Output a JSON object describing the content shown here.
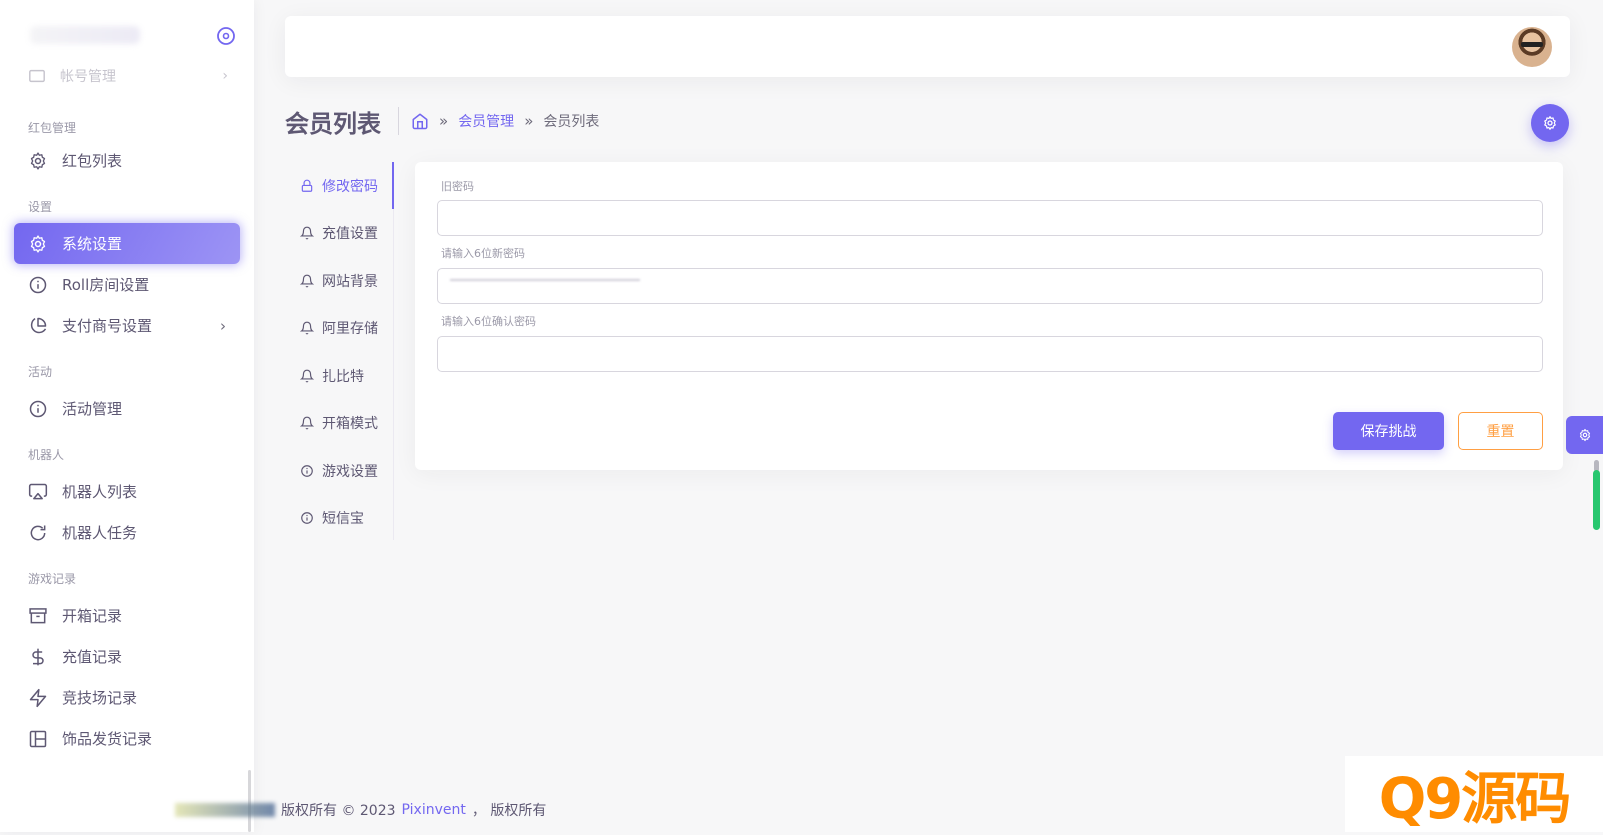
{
  "sidebar": {
    "faded_item": "帐号管理",
    "sections": {
      "hongbao": "红包管理",
      "settings": "设置",
      "activity": "活动",
      "robot": "机器人",
      "game_records": "游戏记录"
    },
    "items": {
      "hongbao_list": "红包列表",
      "system_settings": "系统设置",
      "roll_room": "Roll房间设置",
      "payment_merchant": "支付商号设置",
      "activity_manage": "活动管理",
      "robot_list": "机器人列表",
      "robot_task": "机器人任务",
      "unbox_records": "开箱记录",
      "recharge_records": "充值记录",
      "arena_records": "竞技场记录",
      "item_shipping_records": "饰品发货记录"
    }
  },
  "header": {
    "page_title": "会员列表",
    "breadcrumb": {
      "sep": "»",
      "parent": "会员管理",
      "current": "会员列表"
    }
  },
  "tabs": [
    {
      "label": "修改密码",
      "icon": "lock-icon",
      "active": true
    },
    {
      "label": "充值设置",
      "icon": "bell-icon"
    },
    {
      "label": "网站背景",
      "icon": "bell-icon"
    },
    {
      "label": "阿里存储",
      "icon": "bell-icon"
    },
    {
      "label": "扎比特",
      "icon": "bell-icon"
    },
    {
      "label": "开箱模式",
      "icon": "bell-icon"
    },
    {
      "label": "游戏设置",
      "icon": "info-icon"
    },
    {
      "label": "短信宝",
      "icon": "info-icon"
    }
  ],
  "form": {
    "old_password_label": "旧密码",
    "new_password_label": "请输入6位新密码",
    "confirm_password_label": "请输入6位确认密码",
    "save_label": "保存挑战",
    "reset_label": "重置"
  },
  "footer": {
    "prefix": "版权所有 © 2023",
    "brand": "Pixinvent",
    "suffix": "，  版权所有"
  },
  "watermark": "Q9源码",
  "colors": {
    "primary": "#7367f0",
    "warning": "#ff9f43",
    "success": "#28c76f",
    "text": "#5e5873"
  }
}
